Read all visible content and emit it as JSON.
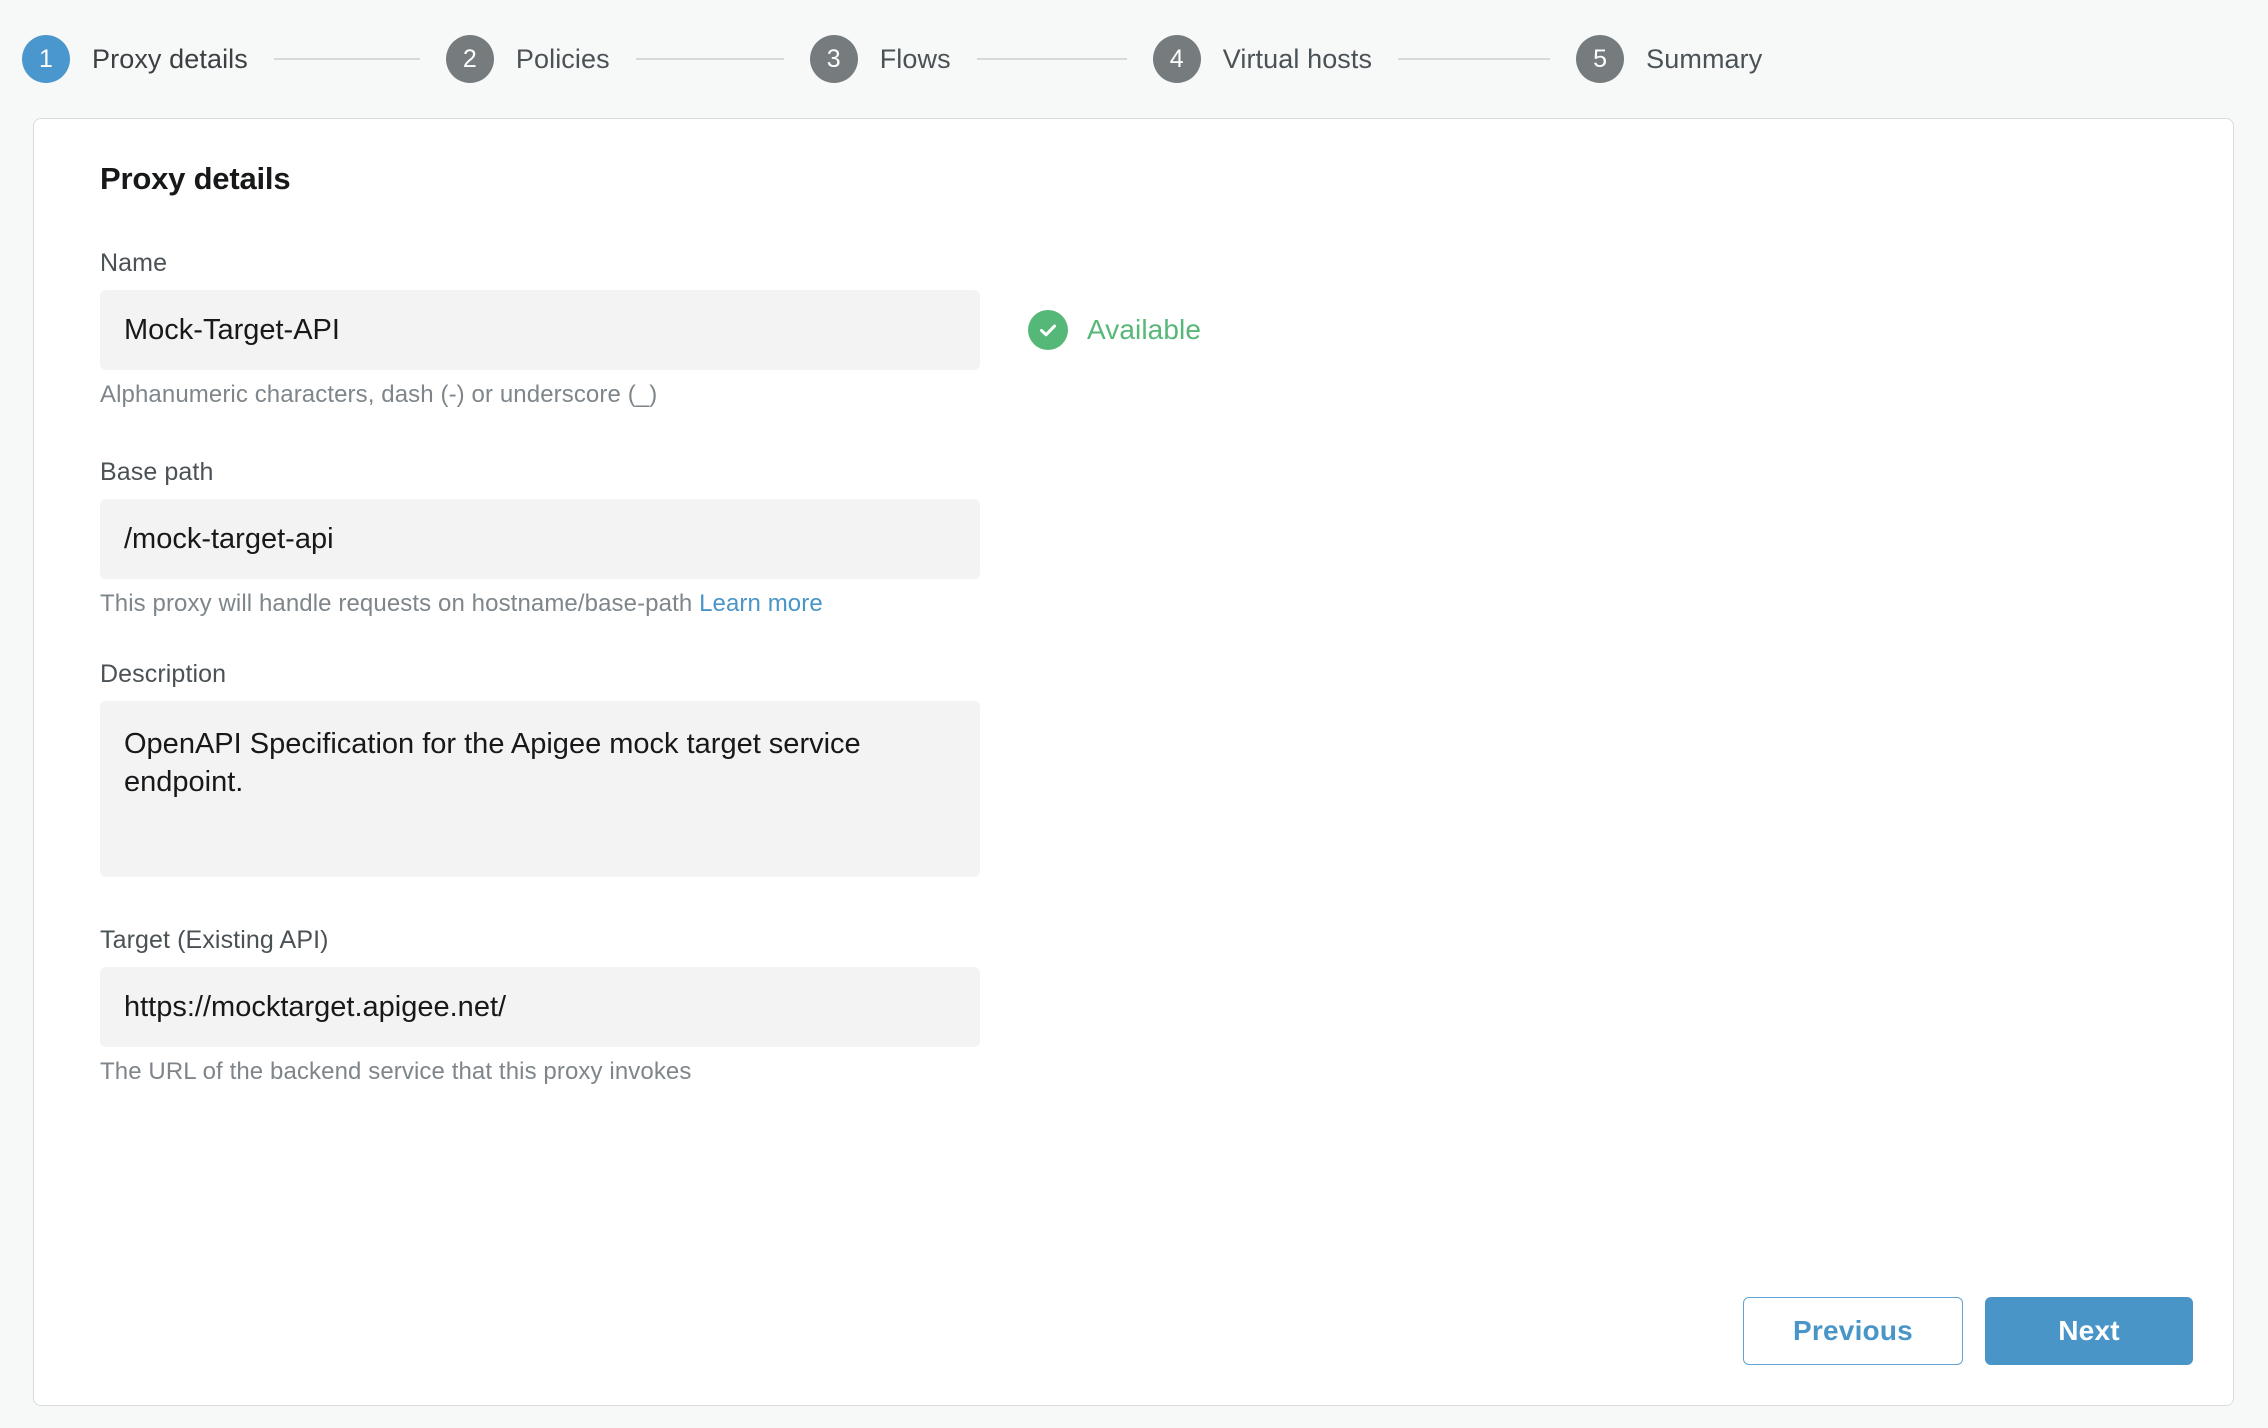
{
  "stepper": {
    "steps": [
      {
        "number": "1",
        "label": "Proxy details",
        "state": "active"
      },
      {
        "number": "2",
        "label": "Policies",
        "state": "inactive"
      },
      {
        "number": "3",
        "label": "Flows",
        "state": "inactive"
      },
      {
        "number": "4",
        "label": "Virtual hosts",
        "state": "inactive"
      },
      {
        "number": "5",
        "label": "Summary",
        "state": "inactive"
      }
    ]
  },
  "card": {
    "title": "Proxy details",
    "fields": {
      "name": {
        "label": "Name",
        "value": "Mock-Target-API",
        "helper": "Alphanumeric characters, dash (-) or underscore (_)",
        "status_icon": "check-circle-icon",
        "status_text": "Available"
      },
      "base_path": {
        "label": "Base path",
        "value": "/mock-target-api",
        "helper_prefix": "This proxy will handle requests on hostname/base-path ",
        "helper_link": "Learn more"
      },
      "description": {
        "label": "Description",
        "value": "OpenAPI Specification for the Apigee mock target service endpoint."
      },
      "target": {
        "label": "Target (Existing API)",
        "value": "https://mocktarget.apigee.net/",
        "helper": "The URL of the backend service that this proxy invokes"
      }
    },
    "footer": {
      "previous_label": "Previous",
      "next_label": "Next"
    }
  },
  "colors": {
    "accent_blue": "#4A95C8",
    "step_inactive_gray": "#767B7E",
    "success_green": "#56B878",
    "page_background": "#F7F8F8",
    "input_background": "#F3F3F3",
    "card_border": "#D9DCDE"
  }
}
